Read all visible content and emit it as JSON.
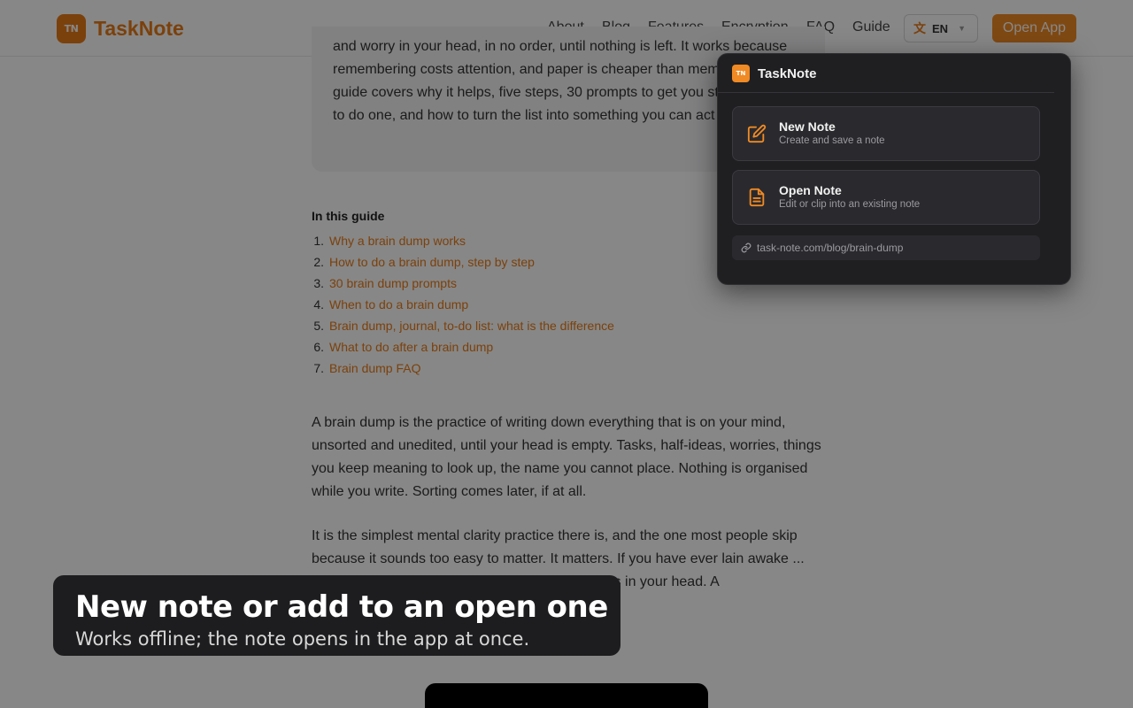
{
  "header": {
    "logo_mark": "TN",
    "logo_text": "TaskNote",
    "nav": [
      "About",
      "Blog",
      "Features",
      "Encryption",
      "FAQ",
      "Guide"
    ],
    "lang": "EN",
    "open_app": "Open App"
  },
  "article": {
    "intro": "and worry in your head, in no order, until nothing is left. It works because remembering costs attention, and paper is cheaper than memory. This guide covers why it helps, five steps, 30 prompts to get you started, when to do one, and how to turn the list into something you can act on.",
    "toc_title": "In this guide",
    "toc": [
      "Why a brain dump works",
      "How to do a brain dump, step by step",
      "30 brain dump prompts",
      "When to do a brain dump",
      "Brain dump, journal, to-do list: what is the difference",
      "What to do after a brain dump",
      "Brain dump FAQ"
    ],
    "para1": "A brain dump is the practice of writing down everything that is on your mind, unsorted and unedited, until your head is empty. Tasks, half-ideas, worries, things you keep meaning to look up, the name you cannot place. Nothing is organised while you write. Sorting comes later, if at all.",
    "para2": "It is the simplest mental clarity practice there is, and the one most people skip because it sounds too easy to matter. It matters. If you have ever lain awake ... without having done anything ... unfinished things in your head. A"
  },
  "popup": {
    "logo_mark": "TN",
    "title": "TaskNote",
    "actions": [
      {
        "title": "New Note",
        "subtitle": "Create and save a note",
        "icon": "edit-icon"
      },
      {
        "title": "Open Note",
        "subtitle": "Edit or clip into an existing note",
        "icon": "document-icon"
      }
    ],
    "url": "task-note.com/blog/brain-dump"
  },
  "caption": {
    "title": "New note or add to an open one",
    "subtitle": "Works offline; the note opens in the app at once."
  },
  "colors": {
    "accent": "#f08a24",
    "popup_bg": "#1f1f22",
    "overlay": "rgba(0,0,0,0.47)"
  }
}
